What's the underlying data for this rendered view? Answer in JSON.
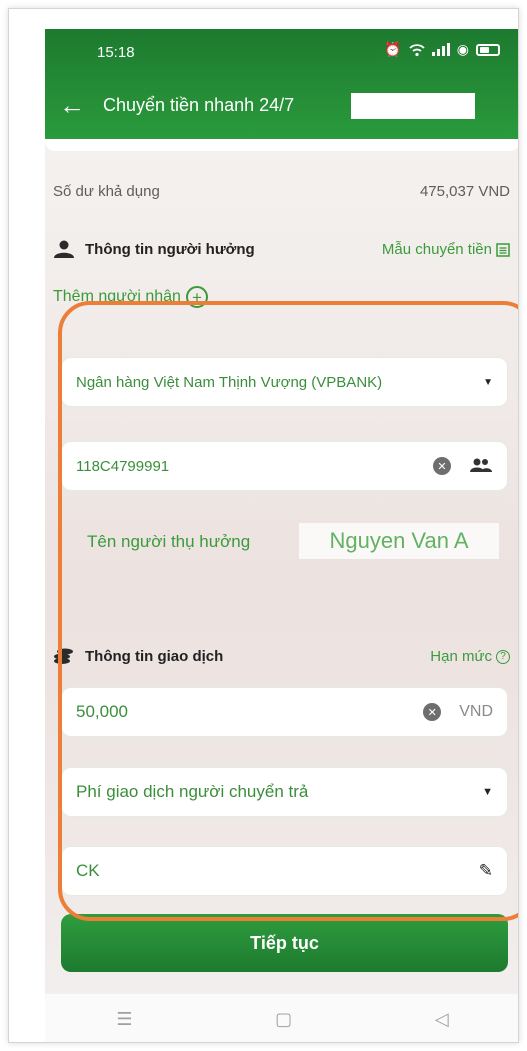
{
  "status_bar": {
    "time": "15:18"
  },
  "header": {
    "title": "Chuyển tiền nhanh 24/7"
  },
  "balance": {
    "label": "Số dư khả dụng",
    "value": "475,037 VND"
  },
  "beneficiary_section": {
    "title": "Thông tin người hưởng",
    "link": "Mẫu chuyển tiền"
  },
  "add_receiver": "Thêm người nhận",
  "bank_field": {
    "value": "Ngân hàng Việt Nam Thịnh Vượng (VPBANK)"
  },
  "account_field": {
    "value": "118C4799991"
  },
  "beneficiary_name": {
    "label": "Tên người thụ hưởng",
    "value": "Nguyen Van A"
  },
  "transaction_section": {
    "title": "Thông tin giao dịch",
    "link": "Hạn mức"
  },
  "amount_field": {
    "value": "50,000",
    "unit": "VND"
  },
  "fee_field": {
    "value": "Phí giao dịch người chuyển trả"
  },
  "note_field": {
    "value": "CK"
  },
  "continue_button": {
    "label": "Tiếp tục"
  },
  "colors": {
    "primary_green": "#2a9a3c",
    "highlight_orange": "#ec7e38"
  }
}
